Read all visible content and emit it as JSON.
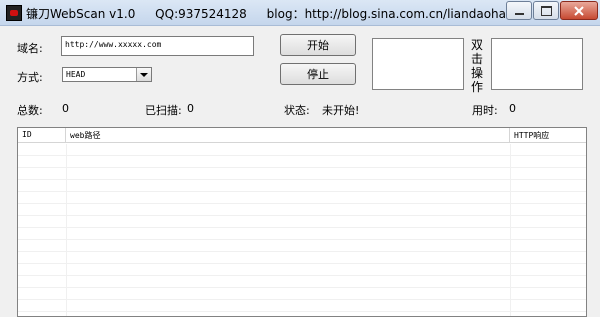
{
  "window": {
    "app_name": "镰刀WebScan v1.0",
    "qq": "QQ:937524128",
    "blog": "blog：http://blog.sina.com.cn/liandaohack"
  },
  "form": {
    "domain_label": "域名:",
    "domain_value": "http://www.xxxxx.com",
    "method_label": "方式:",
    "method_value": "HEAD",
    "start_button": "开始",
    "stop_button": "停止",
    "dblclick_label": "双击操作"
  },
  "status": {
    "total_label": "总数:",
    "total_value": "0",
    "scanned_label": "已扫描:",
    "scanned_value": "0",
    "state_label": "状态:",
    "state_value": "未开始!",
    "time_label": "用时:",
    "time_value": "0"
  },
  "table": {
    "columns": [
      "ID",
      "web路径",
      "HTTP响应"
    ]
  }
}
